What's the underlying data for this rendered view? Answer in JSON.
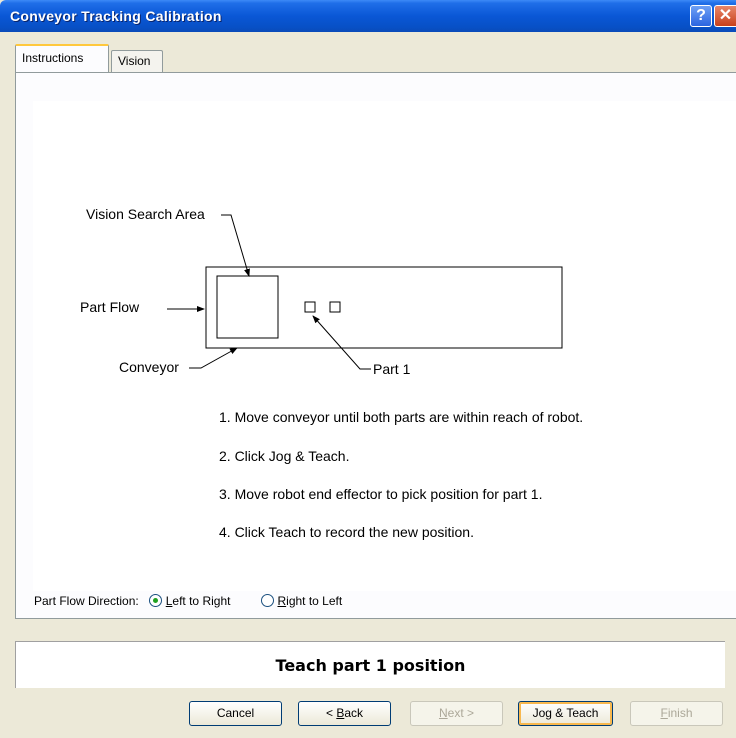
{
  "window": {
    "title": "Conveyor Tracking Calibration",
    "help_glyph": "?",
    "close_glyph": "✕"
  },
  "tabs": [
    {
      "label": "Instructions",
      "active": true
    },
    {
      "label": "Vision",
      "active": false
    }
  ],
  "diagram": {
    "vision_search_area_label": "Vision Search Area",
    "part_flow_label": "Part Flow",
    "conveyor_label": "Conveyor",
    "part1_label": "Part 1"
  },
  "instructions": [
    "1. Move conveyor until both parts are within reach of robot.",
    "2. Click Jog & Teach.",
    "3. Move robot end effector to pick position for part 1.",
    "4. Click Teach to record the new position."
  ],
  "part_flow_direction": {
    "label": "Part Flow Direction:",
    "options": [
      {
        "prefix": "",
        "mnemonic": "L",
        "rest": "eft to Right",
        "selected": true
      },
      {
        "prefix": "",
        "mnemonic": "R",
        "rest": "ight to Left",
        "selected": false
      }
    ]
  },
  "status_message": "Teach part 1 position",
  "buttons": {
    "cancel": "Cancel",
    "back_prefix": "< ",
    "back_mnemonic": "B",
    "back_rest": "ack",
    "next_mnemonic": "N",
    "next_rest": "ext >",
    "jog_teach": "Jog & Teach",
    "finish_mnemonic": "F",
    "finish_rest": "inish"
  }
}
